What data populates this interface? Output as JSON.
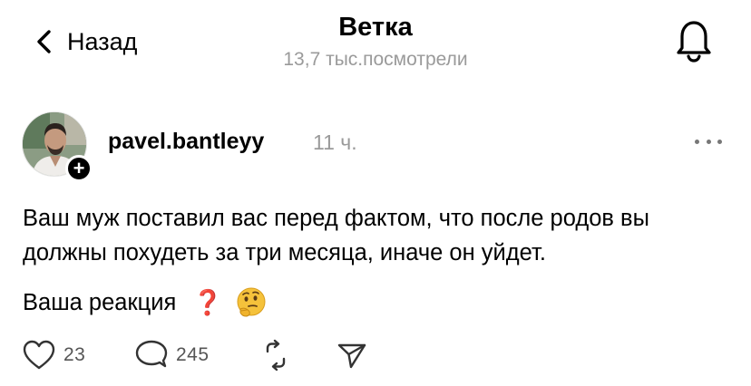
{
  "header": {
    "back_label": "Назад",
    "title": "Ветка",
    "views": "13,7 тыс.посмотрели"
  },
  "post": {
    "username": "pavel.bantleyy",
    "time": "11 ч.",
    "text": "Ваш муж поставил вас перед фактом, что после родов вы должны похудеть за три месяца, иначе он уйдет.",
    "reaction_text": "Ваша реакция",
    "reaction_emojis": [
      "❓",
      "🤔"
    ],
    "likes": "23",
    "replies": "245"
  },
  "icons": {
    "back": "chevron-left-icon",
    "notifications": "bell-icon",
    "more": "more-dots-icon",
    "like": "heart-icon",
    "reply": "comment-icon",
    "repost": "repost-icon",
    "share": "send-icon"
  },
  "colors": {
    "text": "#000000",
    "muted": "#9a9a9a",
    "question": "#d81f2a"
  }
}
